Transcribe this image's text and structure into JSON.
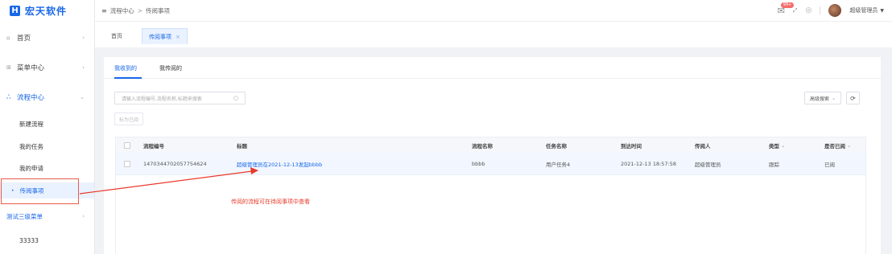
{
  "app": {
    "logo_mark": "H",
    "logo_text": "宏天软件"
  },
  "header": {
    "fold_icon": "≡",
    "breadcrumb": [
      "流程中心",
      "传阅事项"
    ],
    "notify_badge": "99+",
    "user_name": "超级管理员"
  },
  "sidebar": {
    "items": [
      {
        "label": "首页",
        "icon": "home-icon"
      },
      {
        "label": "菜单中心",
        "icon": "grid-icon"
      },
      {
        "label": "流程中心",
        "icon": "flow-icon"
      }
    ],
    "subitems": [
      "新建流程",
      "我的任务",
      "我的申请",
      "传阅事项"
    ],
    "extra_items": [
      {
        "label": "测试三级菜单"
      },
      {
        "label": "33333"
      }
    ]
  },
  "tabs": {
    "home": "首页",
    "current": "传阅事项",
    "close": "×"
  },
  "subtabs": [
    "我收到的",
    "我传阅的"
  ],
  "search": {
    "placeholder": "请输入流程编号,流程名称,标题来搜索"
  },
  "buttons": {
    "mark_read": "标为已阅",
    "advanced_search": "高级搜索",
    "refresh": "⟳"
  },
  "table": {
    "columns": [
      "流程编号",
      "标题",
      "流程名称",
      "任务名称",
      "到达时间",
      "传阅人",
      "类型",
      "是否已阅"
    ],
    "rows": [
      {
        "id": "1470344702057754624",
        "title": "超级管理员在2021-12-13发起bbbb",
        "process_name": "bbbb",
        "task_name": "用户任务4",
        "arrival_time": "2021-12-13 18:57:58",
        "sender": "超级管理员",
        "type": "跟踪",
        "read_status": "已阅"
      }
    ]
  },
  "annotation": "传阅的流程可在待阅事项中查看",
  "colors": {
    "accent": "#1767e8",
    "annotation": "#e8392a"
  }
}
